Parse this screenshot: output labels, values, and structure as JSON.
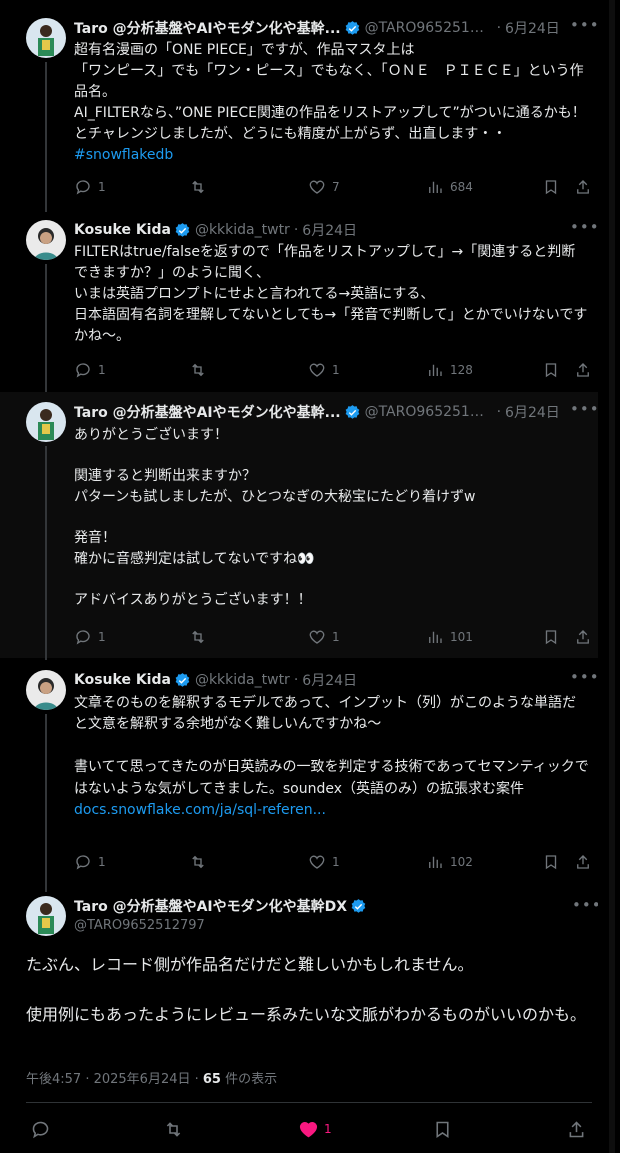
{
  "tweets": [
    {
      "name": "Taro @分析基盤やAIやモダン化や基幹...",
      "handle": "@TARO96525127...",
      "date": "6月24日",
      "text": "超有名漫画の「ONE PIECE」ですが、作品マスタ上は\n「ワンピース」でも「ワン・ピース」でもなく、「ＯＮＥ　ＰＩＥＣＥ」という作品名。\nAI_FILTERなら、”ONE PIECE関連の作品をリストアップして”がついに通るかも！とチャレンジしましたが、どうにも精度が上がらず、出直します・・",
      "hashtag": "#snowflakedb",
      "replies": "1",
      "retweets": "",
      "likes": "7",
      "views": "684"
    },
    {
      "name": "Kosuke Kida",
      "handle": "@kkkida_twtr",
      "date": "6月24日",
      "text": "FILTERはtrue/falseを返すので「作品をリストアップして」→「関連すると判断できますか？」のように聞く、\nいまは英語プロンプトにせよと言われてる→英語にする、\n日本語固有名詞を理解してないとしても→「発音で判断して」とかでいけないですかね〜。",
      "replies": "1",
      "retweets": "",
      "likes": "1",
      "views": "128"
    },
    {
      "name": "Taro @分析基盤やAIやモダン化や基幹...",
      "handle": "@TARO96525127...",
      "date": "6月24日",
      "text": "ありがとうございます！\n\n関連すると判断出来ますか？\nパターンも試しましたが、ひとつなぎの大秘宝にたどり着けずw\n\n発音！\n確かに音感判定は試してないですね👀\n\nアドバイスありがとうございます！！",
      "replies": "1",
      "retweets": "",
      "likes": "1",
      "views": "101"
    },
    {
      "name": "Kosuke Kida",
      "handle": "@kkkida_twtr",
      "date": "6月24日",
      "text": "文章そのものを解釈するモデルであって、インプット（列）がこのような単語だと文意を解釈する余地がなく難しいんですかね〜\n\n書いてて思ってきたのが日英読みの一致を判定する技術であってセマンティックではないような気がしてきました。soundex（英語のみ）の拡張求む案件",
      "link": "docs.snowflake.com/ja/sql-referen...",
      "replies": "1",
      "retweets": "",
      "likes": "1",
      "views": "102"
    }
  ],
  "main": {
    "name": "Taro @分析基盤やAIやモダン化や基幹DX",
    "handle": "@TARO9652512797",
    "text": "たぶん、レコード側が作品名だけだと難しいかもしれません。\n\n使用例にもあったようにレビュー系みたいな文脈がわかるものがいいのかも。",
    "time": "午後4:57 · 2025年6月24日 · ",
    "views_count": "65",
    "views_label": " 件の表示",
    "likes": "1"
  },
  "colors": {
    "link": "#1d9bf0",
    "like_active": "#f91880",
    "verified": "#1d9bf0",
    "muted": "#71767b"
  },
  "icons": [
    "reply-icon",
    "retweet-icon",
    "like-icon",
    "views-icon",
    "bookmark-icon",
    "share-icon",
    "verified-badge-icon",
    "more-icon"
  ]
}
